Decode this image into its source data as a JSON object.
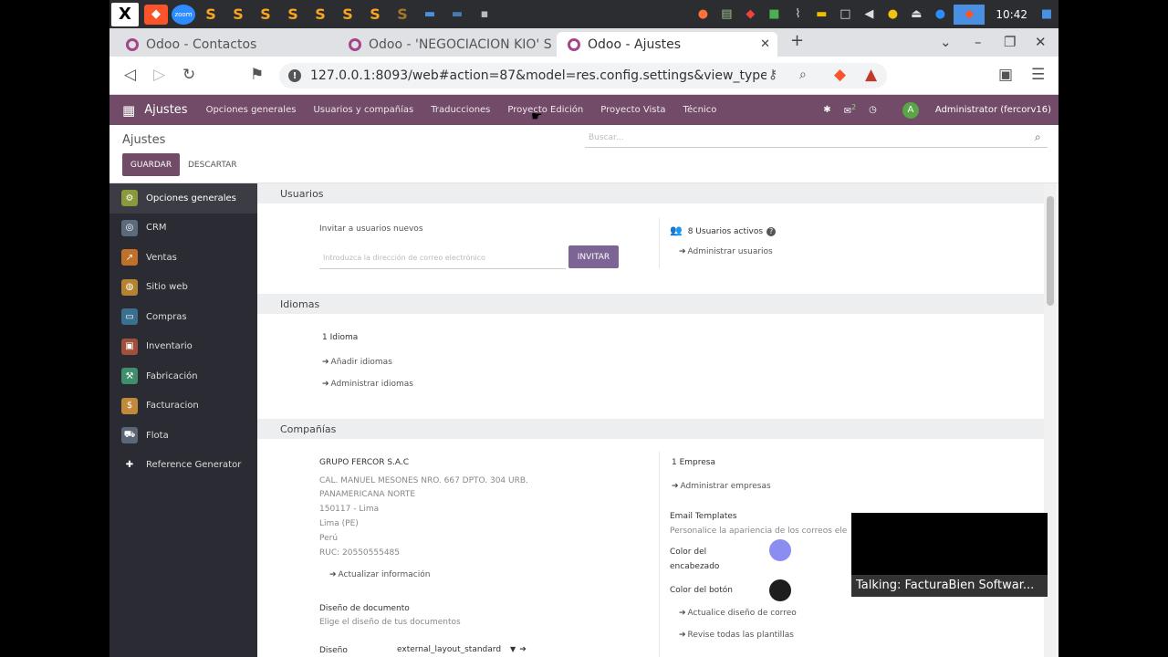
{
  "taskbar": {
    "clock": "10:42"
  },
  "browser": {
    "tabs": [
      {
        "label": "Odoo - Contactos"
      },
      {
        "label": "Odoo - 'NEGOCIACION KIO' S"
      },
      {
        "label": "Odoo - Ajustes"
      }
    ],
    "url": "127.0.0.1:8093/web#action=87&model=res.config.settings&view_type=f..."
  },
  "odoo_nav": {
    "brand": "Ajustes",
    "items": [
      "Opciones generales",
      "Usuarios y compañías",
      "Traducciones",
      "Proyecto Edición",
      "Proyecto Vista",
      "Técnico"
    ],
    "chat_count": "2",
    "avatar_letter": "A",
    "user": "Administrator (fercorv16)"
  },
  "control_panel": {
    "title": "Ajustes",
    "save_label": "GUARDAR",
    "discard_label": "DESCARTAR",
    "search_placeholder": "Buscar..."
  },
  "sidebar": {
    "items": [
      {
        "label": "Opciones generales",
        "color": "#8a9a3a"
      },
      {
        "label": "CRM",
        "color": "#5a6b7c"
      },
      {
        "label": "Ventas",
        "color": "#c0702a"
      },
      {
        "label": "Sitio web",
        "color": "#b5822f"
      },
      {
        "label": "Compras",
        "color": "#3b6f8f"
      },
      {
        "label": "Inventario",
        "color": "#a04f3a"
      },
      {
        "label": "Fabricación",
        "color": "#3f8f6f"
      },
      {
        "label": "Facturacion",
        "color": "#c08a3a"
      },
      {
        "label": "Flota",
        "color": "#5b6677"
      },
      {
        "label": "Reference Generator",
        "color": "#7a8a8f"
      }
    ]
  },
  "usuarios": {
    "header": "Usuarios",
    "invite_label": "Invitar a usuarios nuevos",
    "invite_placeholder": "Introduzca la dirección de correo electrónico",
    "invite_button": "INVITAR",
    "active_users": "8 Usuarios activos",
    "manage_users": "Administrar usuarios"
  },
  "idiomas": {
    "header": "Idiomas",
    "count": "1 Idioma",
    "add": "Añadir idiomas",
    "manage": "Administrar idiomas"
  },
  "companias": {
    "header": "Compañías",
    "company_name": "GRUPO FERCOR S.A.C",
    "address1": "CAL. MANUEL MESONES NRO. 667 DPTO. 304 URB.",
    "address2": "PANAMERICANA NORTE",
    "address3": "150117 - Lima",
    "address4": "Lima (PE)",
    "country": "Perú",
    "ruc": "RUC:  20550555485",
    "update_info": "Actualizar información",
    "doc_design_title": "Diseño de documento",
    "doc_design_sub": "Elige el diseño de tus documentos",
    "design_label": "Diseño",
    "design_value": "external_layout_standard",
    "empresa_count": "1 Empresa",
    "manage_companies": "Administrar empresas",
    "email_templates_title": "Email Templates",
    "email_templates_sub": "Personalice la apariencia de los correos ele",
    "header_color_label": "Color del encabezado",
    "header_color": "#8b8df0",
    "button_color_label": "Color del botón",
    "button_color": "#1e1e1e",
    "update_mail_design": "Actualice diseño de correo",
    "review_templates": "Revise todas las plantillas"
  },
  "zoom": {
    "talking": "Talking: FacturaBien Softwar..."
  }
}
